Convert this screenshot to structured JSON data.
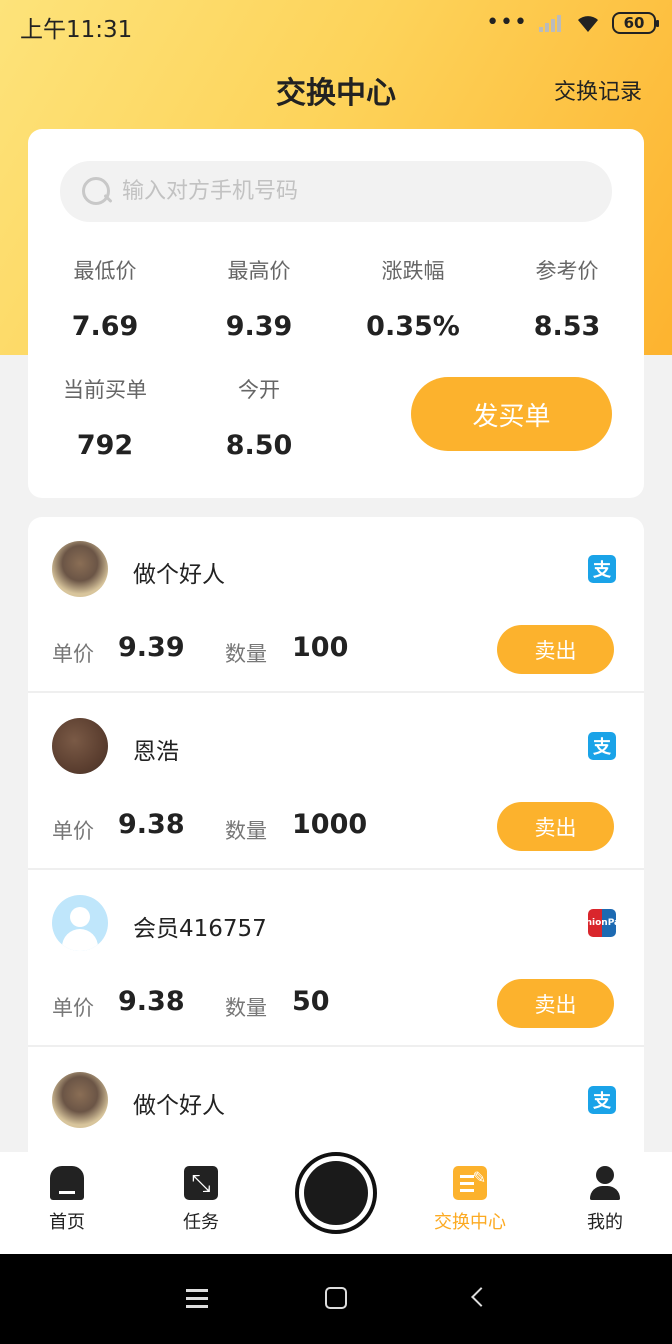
{
  "status_bar": {
    "time": "上午11:31",
    "signal_dots": "•••",
    "battery": "60"
  },
  "header": {
    "title": "交换中心",
    "history_link": "交换记录"
  },
  "search": {
    "placeholder": "输入对方手机号码",
    "value": ""
  },
  "stats": {
    "min_price": {
      "label": "最低价",
      "value": "7.69"
    },
    "max_price": {
      "label": "最高价",
      "value": "9.39"
    },
    "change": {
      "label": "涨跌幅",
      "value": "0.35%"
    },
    "reference": {
      "label": "参考价",
      "value": "8.53"
    },
    "current_buy": {
      "label": "当前买单",
      "value": "792"
    },
    "open_today": {
      "label": "今开",
      "value": "8.50"
    }
  },
  "post_buy_label": "发买单",
  "orders": [
    {
      "name": "做个好人",
      "pay": "alipay",
      "price_label": "单价",
      "price": "9.39",
      "qty_label": "数量",
      "qty": "100",
      "action": "卖出"
    },
    {
      "name": "恩浩",
      "pay": "alipay",
      "price_label": "单价",
      "price": "9.38",
      "qty_label": "数量",
      "qty": "1000",
      "action": "卖出"
    },
    {
      "name": "会员416757",
      "pay": "unionpay",
      "price_label": "单价",
      "price": "9.38",
      "qty_label": "数量",
      "qty": "50",
      "action": "卖出"
    },
    {
      "name": "做个好人",
      "pay": "alipay"
    }
  ],
  "pay_icons": {
    "alipay": "支",
    "unionpay": "UnionPay"
  },
  "bottom_nav": {
    "home": "首页",
    "tasks": "任务",
    "exchange": "交换中心",
    "mine": "我的"
  },
  "colors": {
    "accent": "#fcb22d",
    "header_gradient_start": "#fde37a",
    "header_gradient_end": "#fdb32f"
  }
}
